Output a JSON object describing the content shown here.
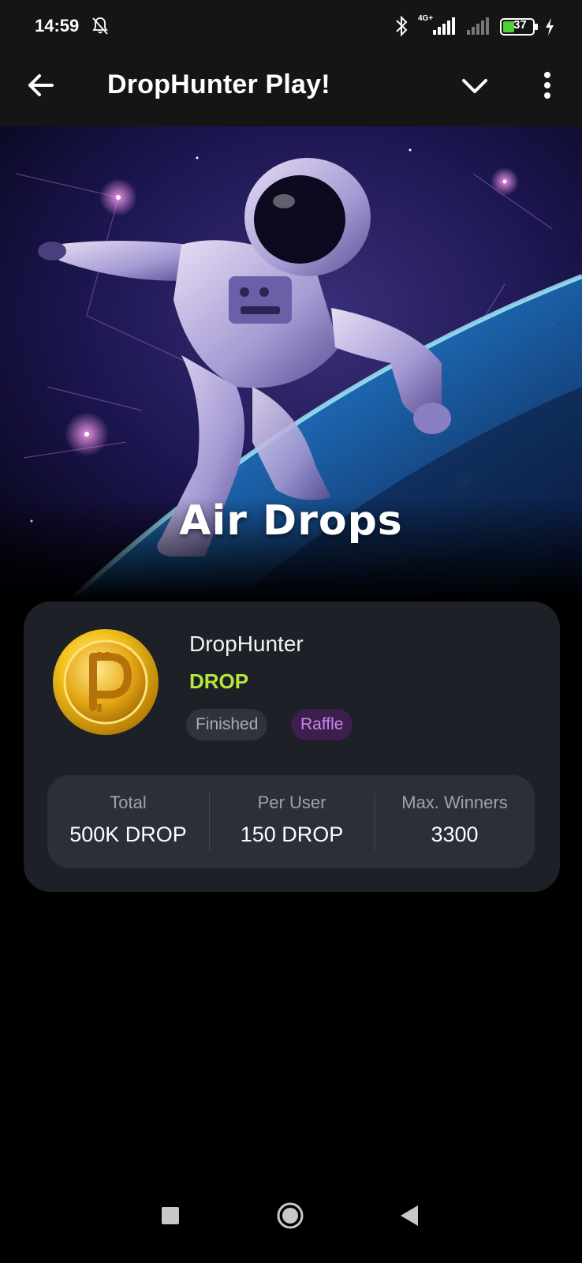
{
  "status_bar": {
    "time": "14:59",
    "battery_level": "37",
    "network_label": "4G+",
    "icons": [
      "notifications-off-icon",
      "bluetooth-icon",
      "signal-icon",
      "signal-icon",
      "battery-icon",
      "charging-icon"
    ]
  },
  "app_bar": {
    "title": "DropHunter Play!",
    "icons": [
      "back-arrow-icon",
      "chevron-down-icon",
      "more-vert-icon"
    ]
  },
  "hero": {
    "title": "Air Drops"
  },
  "airdrop_card": {
    "name": "DropHunter",
    "ticker": "DROP",
    "badges": {
      "status": "Finished",
      "type": "Raffle"
    },
    "stats": [
      {
        "label": "Total",
        "value": "500K DROP"
      },
      {
        "label": "Per User",
        "value": "150 DROP"
      },
      {
        "label": "Max. Winners",
        "value": "3300"
      }
    ]
  },
  "colors": {
    "ticker": "#b6e83a",
    "raffle_badge_text": "#c986ec",
    "raffle_badge_bg": "#3c1f4d",
    "card_bg": "#1d2026",
    "stats_bg": "#2a2f38"
  },
  "nav_bar": {
    "icons": [
      "recents-square-icon",
      "home-circle-icon",
      "back-triangle-icon"
    ]
  }
}
